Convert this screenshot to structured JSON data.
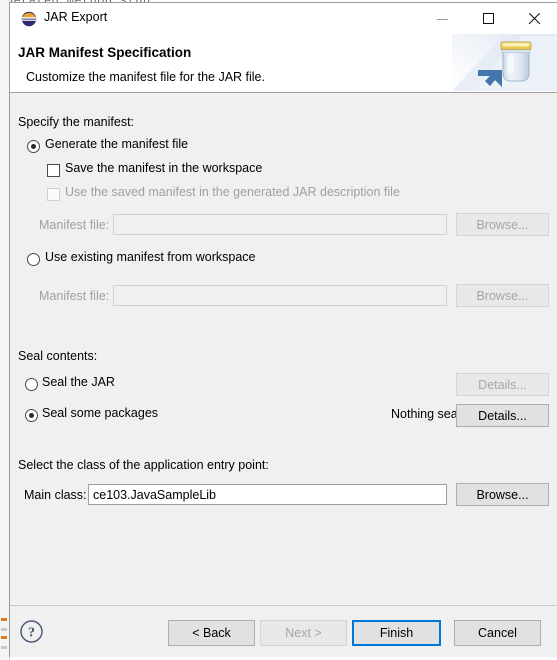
{
  "background": {
    "editor_text": "nerated method stub"
  },
  "titlebar": {
    "title": "JAR Export",
    "icon": "jar-export-icon",
    "minimize_label": "",
    "maximize_label": "",
    "close_label": ""
  },
  "header": {
    "title": "JAR Manifest Specification",
    "description": "Customize the manifest file for the JAR file.",
    "illustration": "jar-with-arrow-illustration"
  },
  "manifest_section": {
    "group_label": "Specify the manifest:",
    "generate_radio": {
      "label": "Generate the manifest file",
      "checked": true
    },
    "save_checkbox": {
      "label": "Save the manifest in the workspace",
      "checked": false,
      "enabled": true
    },
    "use_saved_checkbox": {
      "label": "Use the saved manifest in the generated JAR description file",
      "checked": false,
      "enabled": false
    },
    "manifest_file_label_1": "Manifest file:",
    "manifest_file_value_1": "",
    "browse_button_1": "Browse...",
    "use_existing_radio": {
      "label": "Use existing manifest from workspace",
      "checked": false
    },
    "manifest_file_label_2": "Manifest file:",
    "manifest_file_value_2": "",
    "browse_button_2": "Browse..."
  },
  "seal_section": {
    "group_label": "Seal contents:",
    "seal_jar_radio": {
      "label": "Seal the JAR",
      "checked": false
    },
    "seal_jar_details_button": "Details...",
    "seal_packages_radio": {
      "label": "Seal some packages",
      "checked": true
    },
    "seal_status": "Nothing sealed",
    "seal_packages_details_button": "Details..."
  },
  "entry_point_section": {
    "group_label": "Select the class of the application entry point:",
    "main_class_label": "Main class:",
    "main_class_value": "ce103.JavaSampleLib",
    "browse_button": "Browse..."
  },
  "footer": {
    "help_icon": "help-question-icon",
    "back_button": "< Back",
    "next_button": "Next >",
    "finish_button": "Finish",
    "cancel_button": "Cancel"
  },
  "colors": {
    "accent": "#0078d7",
    "dialog_bg": "#f0f0f0",
    "header_bg": "#ffffff",
    "disabled_text": "#a0a0a0"
  }
}
